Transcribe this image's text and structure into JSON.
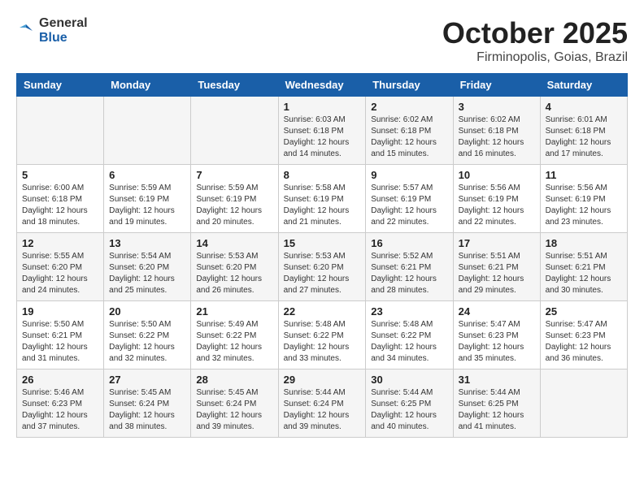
{
  "header": {
    "logo_general": "General",
    "logo_blue": "Blue",
    "month_title": "October 2025",
    "location": "Firminopolis, Goias, Brazil"
  },
  "weekdays": [
    "Sunday",
    "Monday",
    "Tuesday",
    "Wednesday",
    "Thursday",
    "Friday",
    "Saturday"
  ],
  "weeks": [
    [
      {
        "day": "",
        "info": ""
      },
      {
        "day": "",
        "info": ""
      },
      {
        "day": "",
        "info": ""
      },
      {
        "day": "1",
        "info": "Sunrise: 6:03 AM\nSunset: 6:18 PM\nDaylight: 12 hours\nand 14 minutes."
      },
      {
        "day": "2",
        "info": "Sunrise: 6:02 AM\nSunset: 6:18 PM\nDaylight: 12 hours\nand 15 minutes."
      },
      {
        "day": "3",
        "info": "Sunrise: 6:02 AM\nSunset: 6:18 PM\nDaylight: 12 hours\nand 16 minutes."
      },
      {
        "day": "4",
        "info": "Sunrise: 6:01 AM\nSunset: 6:18 PM\nDaylight: 12 hours\nand 17 minutes."
      }
    ],
    [
      {
        "day": "5",
        "info": "Sunrise: 6:00 AM\nSunset: 6:18 PM\nDaylight: 12 hours\nand 18 minutes."
      },
      {
        "day": "6",
        "info": "Sunrise: 5:59 AM\nSunset: 6:19 PM\nDaylight: 12 hours\nand 19 minutes."
      },
      {
        "day": "7",
        "info": "Sunrise: 5:59 AM\nSunset: 6:19 PM\nDaylight: 12 hours\nand 20 minutes."
      },
      {
        "day": "8",
        "info": "Sunrise: 5:58 AM\nSunset: 6:19 PM\nDaylight: 12 hours\nand 21 minutes."
      },
      {
        "day": "9",
        "info": "Sunrise: 5:57 AM\nSunset: 6:19 PM\nDaylight: 12 hours\nand 22 minutes."
      },
      {
        "day": "10",
        "info": "Sunrise: 5:56 AM\nSunset: 6:19 PM\nDaylight: 12 hours\nand 22 minutes."
      },
      {
        "day": "11",
        "info": "Sunrise: 5:56 AM\nSunset: 6:19 PM\nDaylight: 12 hours\nand 23 minutes."
      }
    ],
    [
      {
        "day": "12",
        "info": "Sunrise: 5:55 AM\nSunset: 6:20 PM\nDaylight: 12 hours\nand 24 minutes."
      },
      {
        "day": "13",
        "info": "Sunrise: 5:54 AM\nSunset: 6:20 PM\nDaylight: 12 hours\nand 25 minutes."
      },
      {
        "day": "14",
        "info": "Sunrise: 5:53 AM\nSunset: 6:20 PM\nDaylight: 12 hours\nand 26 minutes."
      },
      {
        "day": "15",
        "info": "Sunrise: 5:53 AM\nSunset: 6:20 PM\nDaylight: 12 hours\nand 27 minutes."
      },
      {
        "day": "16",
        "info": "Sunrise: 5:52 AM\nSunset: 6:21 PM\nDaylight: 12 hours\nand 28 minutes."
      },
      {
        "day": "17",
        "info": "Sunrise: 5:51 AM\nSunset: 6:21 PM\nDaylight: 12 hours\nand 29 minutes."
      },
      {
        "day": "18",
        "info": "Sunrise: 5:51 AM\nSunset: 6:21 PM\nDaylight: 12 hours\nand 30 minutes."
      }
    ],
    [
      {
        "day": "19",
        "info": "Sunrise: 5:50 AM\nSunset: 6:21 PM\nDaylight: 12 hours\nand 31 minutes."
      },
      {
        "day": "20",
        "info": "Sunrise: 5:50 AM\nSunset: 6:22 PM\nDaylight: 12 hours\nand 32 minutes."
      },
      {
        "day": "21",
        "info": "Sunrise: 5:49 AM\nSunset: 6:22 PM\nDaylight: 12 hours\nand 32 minutes."
      },
      {
        "day": "22",
        "info": "Sunrise: 5:48 AM\nSunset: 6:22 PM\nDaylight: 12 hours\nand 33 minutes."
      },
      {
        "day": "23",
        "info": "Sunrise: 5:48 AM\nSunset: 6:22 PM\nDaylight: 12 hours\nand 34 minutes."
      },
      {
        "day": "24",
        "info": "Sunrise: 5:47 AM\nSunset: 6:23 PM\nDaylight: 12 hours\nand 35 minutes."
      },
      {
        "day": "25",
        "info": "Sunrise: 5:47 AM\nSunset: 6:23 PM\nDaylight: 12 hours\nand 36 minutes."
      }
    ],
    [
      {
        "day": "26",
        "info": "Sunrise: 5:46 AM\nSunset: 6:23 PM\nDaylight: 12 hours\nand 37 minutes."
      },
      {
        "day": "27",
        "info": "Sunrise: 5:45 AM\nSunset: 6:24 PM\nDaylight: 12 hours\nand 38 minutes."
      },
      {
        "day": "28",
        "info": "Sunrise: 5:45 AM\nSunset: 6:24 PM\nDaylight: 12 hours\nand 39 minutes."
      },
      {
        "day": "29",
        "info": "Sunrise: 5:44 AM\nSunset: 6:24 PM\nDaylight: 12 hours\nand 39 minutes."
      },
      {
        "day": "30",
        "info": "Sunrise: 5:44 AM\nSunset: 6:25 PM\nDaylight: 12 hours\nand 40 minutes."
      },
      {
        "day": "31",
        "info": "Sunrise: 5:44 AM\nSunset: 6:25 PM\nDaylight: 12 hours\nand 41 minutes."
      },
      {
        "day": "",
        "info": ""
      }
    ]
  ]
}
